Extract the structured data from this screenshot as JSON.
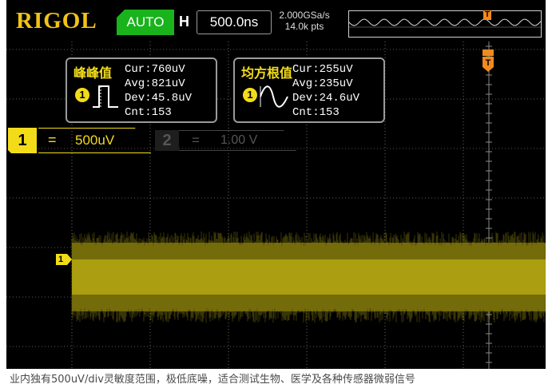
{
  "header": {
    "brand": "RIGOL",
    "trigger_mode": "AUTO",
    "horizontal_label": "H",
    "timebase": "500.0ns",
    "sample_rate": "2.000GSa/s",
    "points": "14.0k pts"
  },
  "measurements": {
    "peak_to_peak": {
      "title": "峰峰值",
      "cur": "Cur:760uV",
      "avg": "Avg:821uV",
      "dev": "Dev:45.8uV",
      "cnt": "Cnt:153",
      "channel": "1"
    },
    "rms": {
      "title": "均方根值",
      "cur": "Cur:255uV",
      "avg": "Avg:235uV",
      "dev": "Dev:24.6uV",
      "cnt": "Cnt:153",
      "channel": "1"
    }
  },
  "channels": {
    "ch1": {
      "label": "1",
      "coupling": "=",
      "scale": "500uV",
      "color": "#f2dc1a"
    },
    "ch2": {
      "label": "2",
      "coupling": "=",
      "scale": "1.00 V",
      "color": "#555555"
    }
  },
  "markers": {
    "ch1_offset_label": "1",
    "trigger_label": "T"
  },
  "colors": {
    "accent": "#f2c316",
    "auto_green": "#19b31c",
    "trigger_orange": "#f08a1c",
    "trace": "#e6d419"
  },
  "caption": "业内独有500uV/div灵敏度范围，极低底噪，适合测试生物、医学及各种传感器微弱信号"
}
